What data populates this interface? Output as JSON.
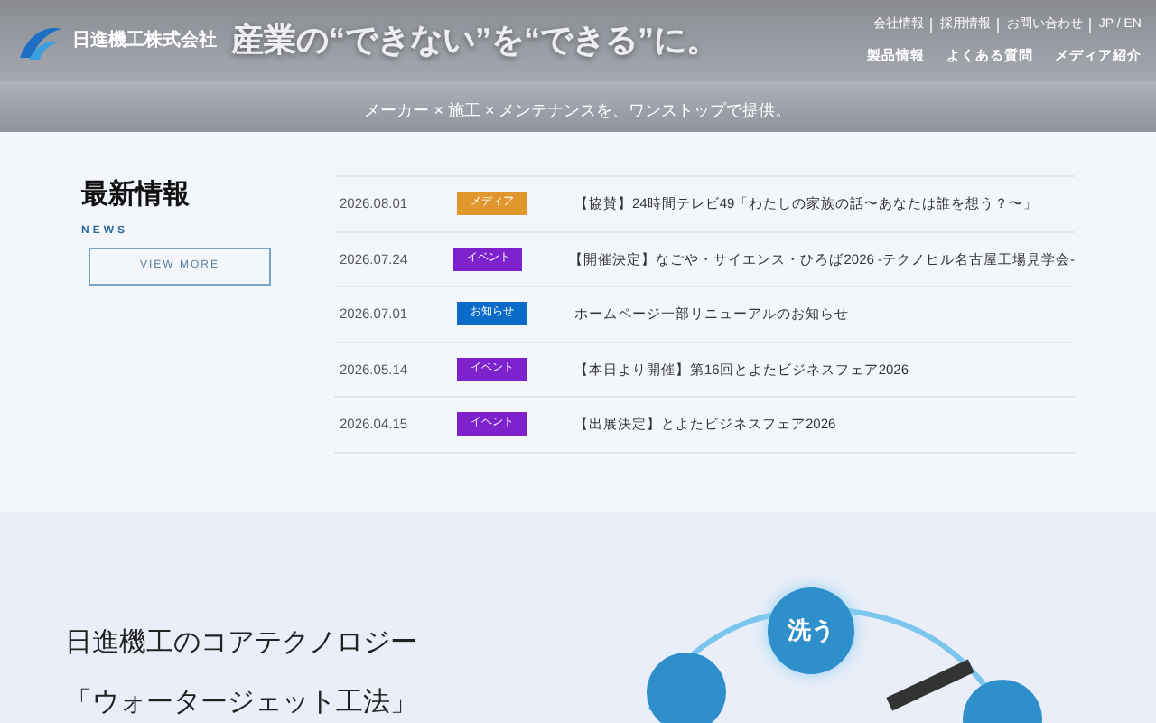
{
  "header": {
    "logo_text": "日進機工株式会社",
    "hero_text": "産業の“できない”を“できる”に。",
    "utility_links": [
      "会社情報",
      "採用情報",
      "お問い合わせ",
      "JP / EN"
    ],
    "nav": [
      "製品情報",
      "よくある質問",
      "メディア紹介"
    ],
    "tagline": "メーカー × 施工 × メンテナンスを、ワンストップで提供。"
  },
  "news": {
    "title": "最新情報",
    "subtitle": "NEWS",
    "button": "VIEW MORE",
    "items": [
      {
        "date": "2026.08.01",
        "tag": "メディア",
        "color": "#e0982e",
        "title": "【協賛】24時間テレビ49「わたしの家族の話〜あなたは誰を想う？〜」"
      },
      {
        "date": "2026.07.24",
        "tag": "イベント",
        "color": "#7e22ce",
        "title": "【開催決定】なごや・サイエンス・ひろば2026 -テクノヒル名古屋工場見学会-"
      },
      {
        "date": "2026.07.01",
        "tag": "お知らせ",
        "color": "#0b6bc9",
        "title": "ホームページ一部リニューアルのお知らせ"
      },
      {
        "date": "2026.05.14",
        "tag": "イベント",
        "color": "#7e22ce",
        "title": "【本日より開催】第16回とよたビジネスフェア2026"
      },
      {
        "date": "2026.04.15",
        "tag": "イベント",
        "color": "#7e22ce",
        "title": "【出展決定】とよたビジネスフェア2026"
      }
    ]
  },
  "core": {
    "lines": [
      "日進機工のコアテクノロジー",
      "「ウォータージェット工法」"
    ],
    "bubble": "洗う"
  }
}
